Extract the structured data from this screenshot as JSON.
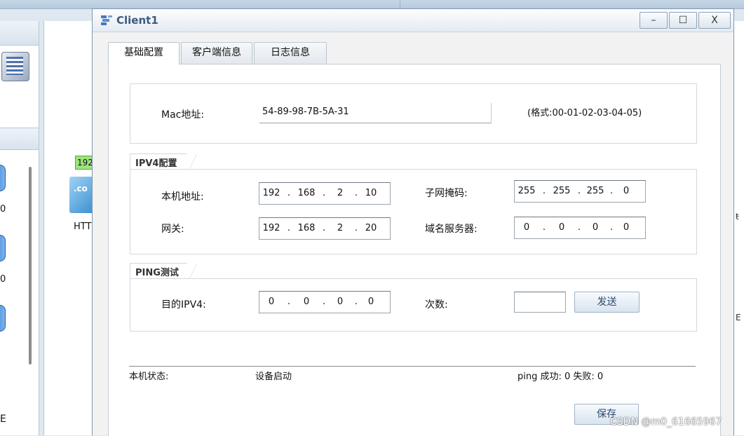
{
  "background": {
    "left_numbers": [
      "0",
      "0"
    ],
    "left_bottom_text": "E",
    "ip_tag": "192",
    "pc_icon_text": ".co",
    "pc_label": "HTT",
    "right_glyphs": [
      "ŧ",
      "E"
    ]
  },
  "window": {
    "title": "Client1",
    "icon": "network-client-icon",
    "controls": {
      "minimize": "–",
      "maximize": "☐",
      "close": "X"
    }
  },
  "tabs": [
    {
      "label": "基础配置",
      "active": true
    },
    {
      "label": "客户端信息",
      "active": false
    },
    {
      "label": "日志信息",
      "active": false
    }
  ],
  "mac": {
    "label": "Mac地址:",
    "value": "54-89-98-7B-5A-31",
    "format_hint": "(格式:00-01-02-03-04-05)"
  },
  "ipv4": {
    "title": "IPV4配置",
    "local_label": "本机地址:",
    "local": [
      "192",
      "168",
      "2",
      "10"
    ],
    "mask_label": "子网掩码:",
    "mask": [
      "255",
      "255",
      "255",
      "0"
    ],
    "gateway_label": "网关:",
    "gateway": [
      "192",
      "168",
      "2",
      "20"
    ],
    "dns_label": "域名服务器:",
    "dns": [
      "0",
      "0",
      "0",
      "0"
    ]
  },
  "ping": {
    "title": "PING测试",
    "dest_label": "目的IPV4:",
    "dest": [
      "0",
      "0",
      "0",
      "0"
    ],
    "count_label": "次数:",
    "count_value": "",
    "send_label": "发送"
  },
  "status": {
    "label": "本机状态:",
    "value": "设备启动",
    "ping_result": "ping 成功: 0 失败: 0"
  },
  "save_label": "保存",
  "watermark": "CSDN @m0_61665967"
}
